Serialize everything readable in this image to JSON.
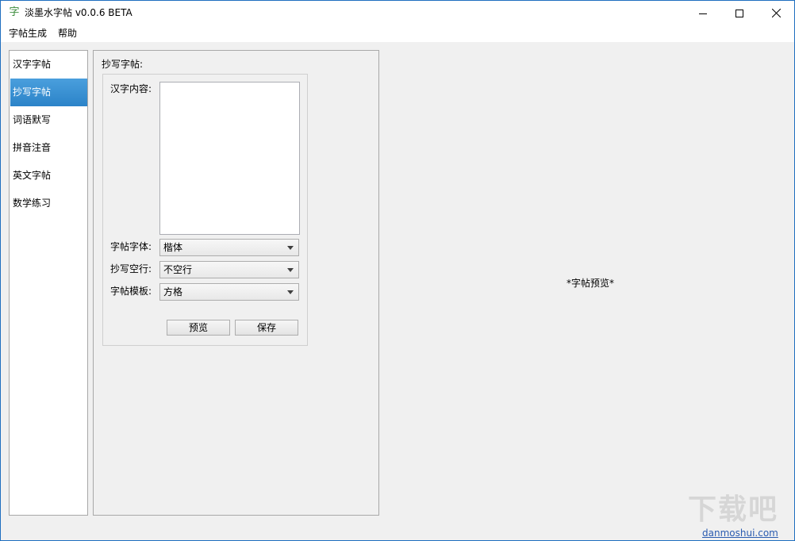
{
  "window": {
    "title": "淡墨水字帖 v0.0.6 BETA",
    "icon_glyph": "字"
  },
  "menubar": {
    "items": [
      "字帖生成",
      "帮助"
    ]
  },
  "sidebar": {
    "items": [
      {
        "label": "汉字字帖",
        "active": false
      },
      {
        "label": "抄写字帖",
        "active": true
      },
      {
        "label": "词语默写",
        "active": false
      },
      {
        "label": "拼音注音",
        "active": false
      },
      {
        "label": "英文字帖",
        "active": false
      },
      {
        "label": "数学练习",
        "active": false
      }
    ]
  },
  "panel": {
    "title": "抄写字帖:",
    "content_label": "汉字内容:",
    "content_value": "",
    "font_label": "字帖字体:",
    "font_value": "楷体",
    "blank_label": "抄写空行:",
    "blank_value": "不空行",
    "template_label": "字帖模板:",
    "template_value": "方格",
    "preview_button": "预览",
    "save_button": "保存"
  },
  "preview": {
    "placeholder": "*字帖预览*"
  },
  "watermark": {
    "glyphs": "下载吧",
    "url": "danmoshui.com"
  },
  "colors": {
    "accent": "#2b83c8",
    "frame": "#1f6fbf",
    "background": "#f0f0f0"
  }
}
